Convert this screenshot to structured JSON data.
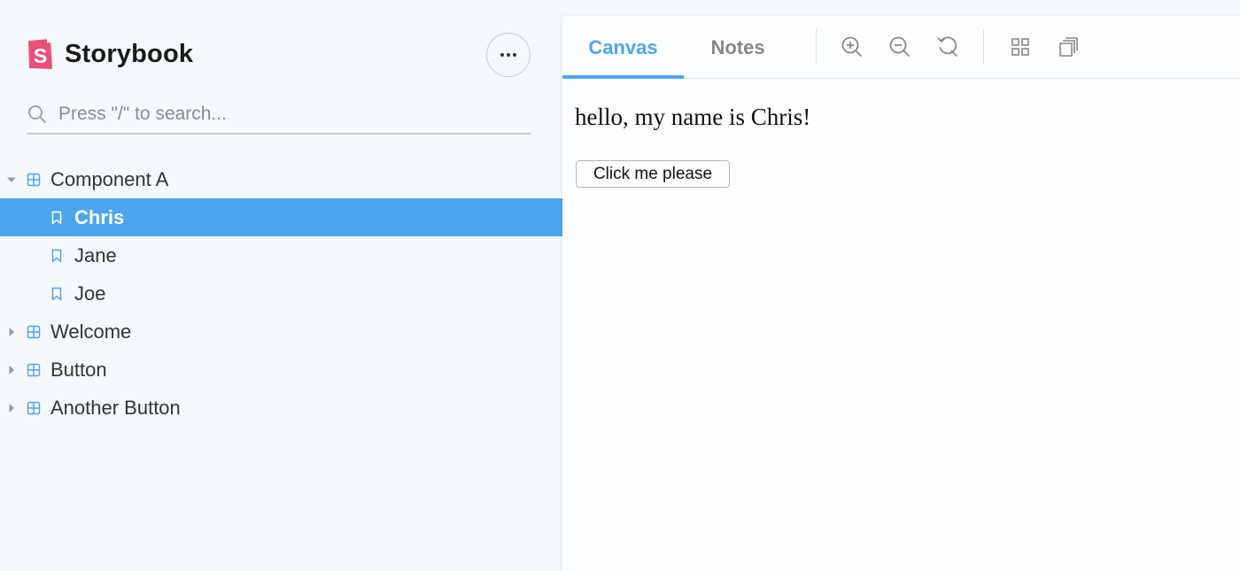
{
  "brand": {
    "name": "Storybook",
    "logo_letter": "S",
    "logo_color": "#e8527a"
  },
  "sidebar": {
    "menu_icon": "ellipsis-icon",
    "search": {
      "placeholder": "Press \"/\" to search...",
      "value": ""
    },
    "tree": [
      {
        "type": "component",
        "label": "Component A",
        "expanded": true,
        "stories": [
          {
            "label": "Chris",
            "selected": true
          },
          {
            "label": "Jane",
            "selected": false
          },
          {
            "label": "Joe",
            "selected": false
          }
        ]
      },
      {
        "type": "component",
        "label": "Welcome",
        "expanded": false
      },
      {
        "type": "component",
        "label": "Button",
        "expanded": false
      },
      {
        "type": "component",
        "label": "Another Button",
        "expanded": false
      }
    ]
  },
  "toolbar": {
    "tabs": [
      {
        "label": "Canvas",
        "active": true
      },
      {
        "label": "Notes",
        "active": false
      }
    ],
    "tools": [
      "zoom-in-icon",
      "zoom-out-icon",
      "reset-zoom-icon",
      "grid-icon",
      "background-icon"
    ]
  },
  "preview": {
    "text": "hello, my name is Chris!",
    "button_label": "Click me please"
  },
  "colors": {
    "accent": "#4da5f0",
    "sidebar_bg": "#f6f9fc",
    "text": "#333333"
  }
}
